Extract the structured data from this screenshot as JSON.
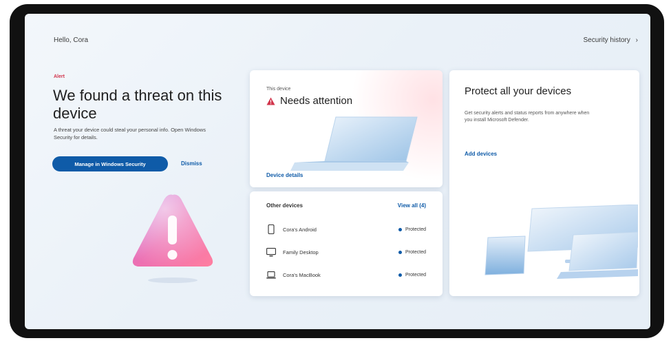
{
  "header": {
    "greeting": "Hello, Cora",
    "security_history": "Security history",
    "history_chevron": "›"
  },
  "alert": {
    "tag": "Alert",
    "title": "We found a threat on this device",
    "description": "A threat your device could steal your personal info. Open Windows Security for details.",
    "manage_button": "Manage in Windows Security",
    "dismiss": "Dismiss"
  },
  "this_device": {
    "label": "This device",
    "status": "Needs attention",
    "details_link": "Device details"
  },
  "other_devices": {
    "title": "Other devices",
    "view_all": "View all (4)",
    "items": [
      {
        "name": "Cora's Android",
        "status": "Protected",
        "icon": "phone-icon"
      },
      {
        "name": "Family Desktop",
        "status": "Protected",
        "icon": "desktop-icon"
      },
      {
        "name": "Cora's MacBook",
        "status": "Protected",
        "icon": "laptop-icon"
      }
    ]
  },
  "protect": {
    "title": "Protect all your devices",
    "description": "Get security alerts and status reports from anywhere when you install Microsoft Defender.",
    "add_devices": "Add devices"
  },
  "colors": {
    "accent": "#0f5ba8",
    "alert": "#d1344b",
    "background": "#eaf1f8"
  }
}
